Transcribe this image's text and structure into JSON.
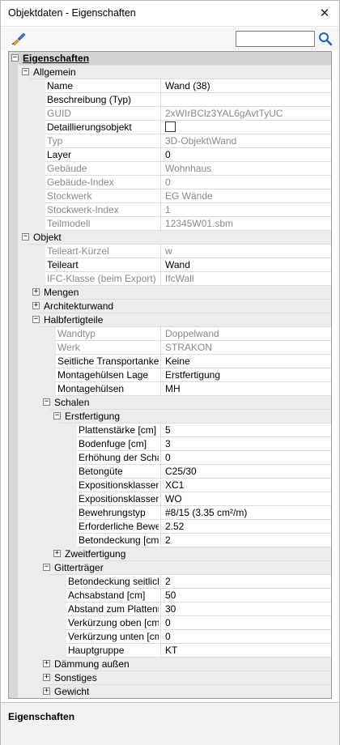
{
  "window": {
    "title": "Objektdaten - Eigenschaften",
    "close_glyph": "✕"
  },
  "toolbar": {
    "search_value": "",
    "search_placeholder": ""
  },
  "rows": [
    {
      "kind": "top",
      "level": 0,
      "expand": "−",
      "name": "Eigenschaften",
      "value": ""
    },
    {
      "kind": "group",
      "level": 1,
      "expand": "−",
      "name": "Allgemein",
      "value": ""
    },
    {
      "kind": "prop",
      "level": 2,
      "name": "Name",
      "value": "Wand (38)"
    },
    {
      "kind": "prop",
      "level": 2,
      "name": "Beschreibung (Typ)",
      "value": ""
    },
    {
      "kind": "prop",
      "level": 2,
      "ro": true,
      "name": "GUID",
      "value": "2xWIrBClz3YAL6gAvtTyUC"
    },
    {
      "kind": "prop",
      "level": 2,
      "name": "Detaillierungsobjekt",
      "value": "",
      "checkbox": true
    },
    {
      "kind": "prop",
      "level": 2,
      "ro": true,
      "name": "Typ",
      "value": "3D-Objekt\\Wand"
    },
    {
      "kind": "prop",
      "level": 2,
      "name": "Layer",
      "value": "0"
    },
    {
      "kind": "prop",
      "level": 2,
      "ro": true,
      "name": "Gebäude",
      "value": "Wohnhaus"
    },
    {
      "kind": "prop",
      "level": 2,
      "ro": true,
      "name": "Gebäude-Index",
      "value": "0"
    },
    {
      "kind": "prop",
      "level": 2,
      "ro": true,
      "name": "Stockwerk",
      "value": "EG Wände"
    },
    {
      "kind": "prop",
      "level": 2,
      "ro": true,
      "name": "Stockwerk-Index",
      "value": "1"
    },
    {
      "kind": "prop",
      "level": 2,
      "ro": true,
      "name": "Teilmodell",
      "value": "12345W01.sbm"
    },
    {
      "kind": "group",
      "level": 1,
      "expand": "−",
      "name": "Objekt",
      "value": ""
    },
    {
      "kind": "prop",
      "level": 2,
      "ro": true,
      "name": "Teileart-Kürzel",
      "value": "w"
    },
    {
      "kind": "prop",
      "level": 2,
      "name": "Teileart",
      "value": "Wand"
    },
    {
      "kind": "prop",
      "level": 2,
      "ro": true,
      "name": "IFC-Klasse (beim Export)",
      "value": "IfcWall"
    },
    {
      "kind": "group",
      "level": 2,
      "expand": "+",
      "name": "Mengen",
      "value": ""
    },
    {
      "kind": "group",
      "level": 2,
      "expand": "+",
      "name": "Architekturwand",
      "value": ""
    },
    {
      "kind": "group",
      "level": 2,
      "expand": "−",
      "name": "Halbfertigteile",
      "value": ""
    },
    {
      "kind": "prop",
      "level": 3,
      "ro": true,
      "name": "Wandtyp",
      "value": "Doppelwand"
    },
    {
      "kind": "prop",
      "level": 3,
      "ro": true,
      "name": "Werk",
      "value": "STRAKON"
    },
    {
      "kind": "prop",
      "level": 3,
      "name": "Seitliche Transportanker",
      "value": "Keine"
    },
    {
      "kind": "prop",
      "level": 3,
      "name": "Montagehülsen Lage",
      "value": "Erstfertigung"
    },
    {
      "kind": "prop",
      "level": 3,
      "name": "Montagehülsen",
      "value": "MH"
    },
    {
      "kind": "group",
      "level": 3,
      "expand": "−",
      "name": "Schalen",
      "value": ""
    },
    {
      "kind": "group",
      "level": 4,
      "expand": "−",
      "name": "Erstfertigung",
      "value": ""
    },
    {
      "kind": "prop",
      "level": 5,
      "name": "Plattenstärke [cm]",
      "value": "5"
    },
    {
      "kind": "prop",
      "level": 5,
      "name": "Bodenfuge [cm]",
      "value": "3"
    },
    {
      "kind": "prop",
      "level": 5,
      "name": "Erhöhung der Schal...",
      "value": "0"
    },
    {
      "kind": "prop",
      "level": 5,
      "name": "Betongüte",
      "value": "C25/30"
    },
    {
      "kind": "prop",
      "level": 5,
      "name": "Expositionsklassen f...",
      "value": "XC1"
    },
    {
      "kind": "prop",
      "level": 5,
      "name": "Expositionsklassen f...",
      "value": "WO"
    },
    {
      "kind": "prop",
      "level": 5,
      "name": "Bewehrungstyp",
      "value": "#8/15   (3.35 cm²/m)"
    },
    {
      "kind": "prop",
      "level": 5,
      "name": "Erforderliche Beweh...",
      "value": "2.52"
    },
    {
      "kind": "prop",
      "level": 5,
      "name": "Betondeckung [cm]",
      "value": "2"
    },
    {
      "kind": "group",
      "level": 4,
      "expand": "+",
      "name": "Zweitfertigung",
      "value": ""
    },
    {
      "kind": "group",
      "level": 3,
      "expand": "−",
      "name": "Gitterträger",
      "value": ""
    },
    {
      "kind": "prop",
      "level": 4,
      "name": "Betondeckung seitlich ...",
      "value": "2"
    },
    {
      "kind": "prop",
      "level": 4,
      "name": "Achsabstand [cm]",
      "value": "50"
    },
    {
      "kind": "prop",
      "level": 4,
      "name": "Abstand zum Plattenra...",
      "value": "30"
    },
    {
      "kind": "prop",
      "level": 4,
      "name": "Verkürzung oben [cm]",
      "value": "0"
    },
    {
      "kind": "prop",
      "level": 4,
      "name": "Verkürzung unten [cm]",
      "value": "0"
    },
    {
      "kind": "prop",
      "level": 4,
      "name": "Hauptgruppe",
      "value": "KT"
    },
    {
      "kind": "group",
      "level": 3,
      "expand": "+",
      "name": "Dämmung außen",
      "value": ""
    },
    {
      "kind": "group",
      "level": 3,
      "expand": "+",
      "name": "Sonstiges",
      "value": ""
    },
    {
      "kind": "group",
      "level": 3,
      "expand": "+",
      "name": "Gewicht",
      "value": ""
    }
  ],
  "footer": {
    "title": "Eigenschaften"
  },
  "icons": {
    "brush": "brush-icon",
    "search": "search-icon",
    "close": "close-icon"
  }
}
